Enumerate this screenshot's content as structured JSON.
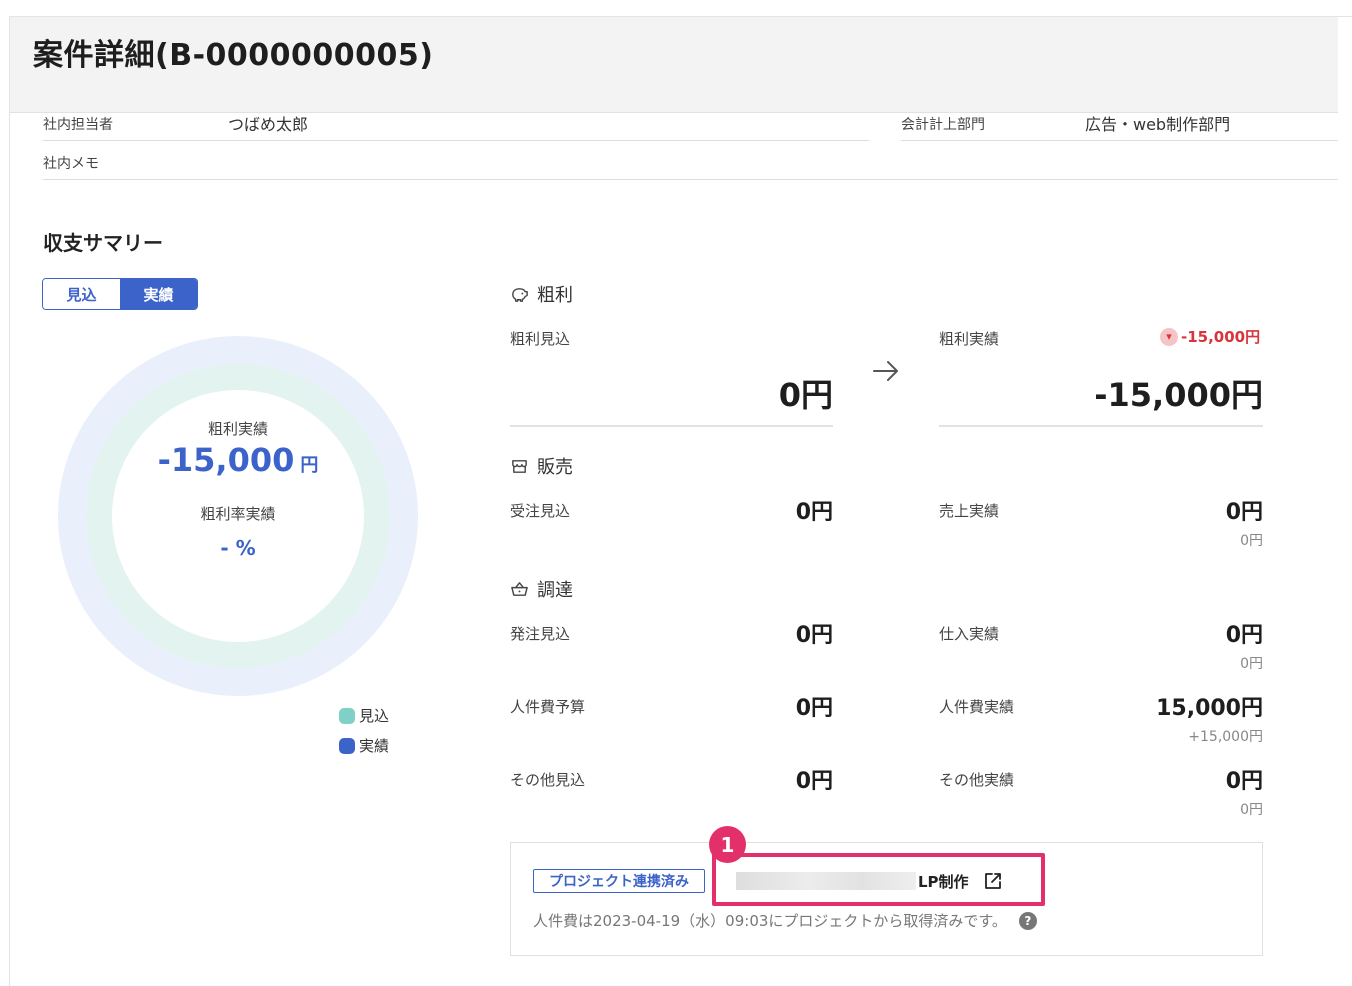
{
  "page": {
    "title": "案件詳細(B-0000000005)"
  },
  "meta": {
    "owner_label": "社内担当者",
    "owner_value": "つばめ太郎",
    "dept_label": "会計計上部門",
    "dept_value": "広告・web制作部門",
    "memo_label": "社内メモ"
  },
  "summary": {
    "title": "収支サマリー",
    "toggle": {
      "forecast": "見込",
      "actual": "実績",
      "selected": "実績"
    },
    "donut": {
      "label1": "粗利実績",
      "value1": "-15,000",
      "unit1": "円",
      "label2": "粗利率実績",
      "value2": "- %",
      "colors": {
        "forecast": "#7fd0c6",
        "actual": "#3b63c9",
        "outer": "#eaf0fb",
        "inner": "#e3f3f0"
      }
    },
    "legend": [
      {
        "label": "見込",
        "color": "#7fd0c6"
      },
      {
        "label": "実績",
        "color": "#3b63c9"
      }
    ]
  },
  "gross": {
    "heading": "粗利",
    "forecast_label": "粗利見込",
    "forecast_value": "0円",
    "actual_label": "粗利実績",
    "actual_value": "-15,000円",
    "delta": "-15,000円"
  },
  "sales": {
    "heading": "販売",
    "forecast_label": "受注見込",
    "forecast_value": "0円",
    "actual_label": "売上実績",
    "actual_value": "0円",
    "actual_diff": "0円"
  },
  "procurement": {
    "heading": "調達",
    "rows": [
      {
        "forecast_label": "発注見込",
        "forecast_value": "0円",
        "actual_label": "仕入実績",
        "actual_value": "0円",
        "actual_diff": "0円"
      },
      {
        "forecast_label": "人件費予算",
        "forecast_value": "0円",
        "actual_label": "人件費実績",
        "actual_value": "15,000円",
        "actual_diff": "+15,000円"
      },
      {
        "forecast_label": "その他見込",
        "forecast_value": "0円",
        "actual_label": "その他実績",
        "actual_value": "0円",
        "actual_diff": "0円"
      }
    ]
  },
  "project": {
    "badge": "プロジェクト連携済み",
    "link_suffix": "LP制作",
    "note": "人件費は2023-04-19（水）09:03にプロジェクトから取得済みです。",
    "annotation_number": "1",
    "accent": "#e3306b"
  }
}
